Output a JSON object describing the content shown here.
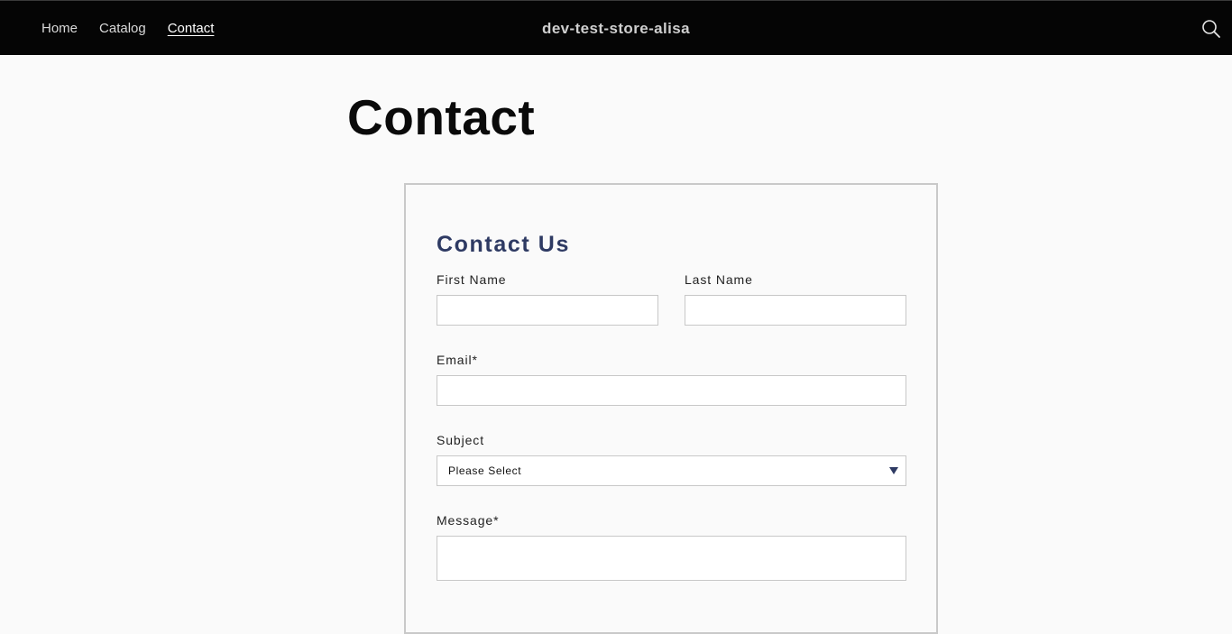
{
  "nav": {
    "items": [
      {
        "label": "Home",
        "active": false
      },
      {
        "label": "Catalog",
        "active": false
      },
      {
        "label": "Contact",
        "active": true
      }
    ],
    "store_name": "dev-test-store-alisa",
    "search_icon": "search-icon"
  },
  "page": {
    "title": "Contact"
  },
  "form": {
    "title": "Contact Us",
    "title_color": "#2e3a63",
    "first_name": {
      "label": "First Name",
      "value": "",
      "placeholder": ""
    },
    "last_name": {
      "label": "Last Name",
      "value": "",
      "placeholder": ""
    },
    "email": {
      "label": "Email*",
      "value": "",
      "placeholder": ""
    },
    "subject": {
      "label": "Subject",
      "selected": "Please Select"
    },
    "message": {
      "label": "Message*",
      "value": "",
      "placeholder": ""
    }
  },
  "colors": {
    "topbar": "#050505",
    "background": "#fafafa",
    "accent": "#2e3a63"
  }
}
